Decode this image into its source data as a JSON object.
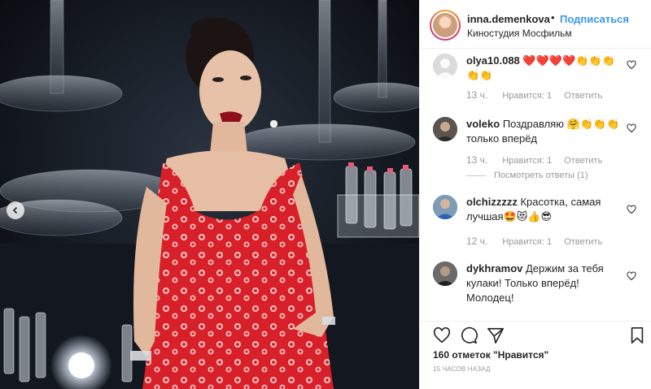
{
  "post": {
    "username": "inna.demenkova",
    "separator": "•",
    "follow_label": "Подписаться",
    "location": "Киностудия Мосфильм"
  },
  "comments": [
    {
      "username": "olya10.088",
      "text": "❤️❤️❤️❤️👏👏👏👏👏",
      "time": "13 ч.",
      "likes": "Нравится: 1",
      "reply_label": "Ответить"
    },
    {
      "username": "voleko",
      "text": "Поздравляю 🤗👏👏👏 только вперёд",
      "time": "13 ч.",
      "likes": "Нравится: 1",
      "reply_label": "Ответить",
      "view_replies": "Посмотреть ответы (1)"
    },
    {
      "username": "olchizzzzz",
      "text": "Красотка, самая лучшая🤩😻👍😎",
      "time": "12 ч.",
      "likes": "Нравится: 1",
      "reply_label": "Ответить"
    },
    {
      "username": "dykhramov",
      "text": "Держим за тебя кулаки! Только вперёд! Молодец!"
    }
  ],
  "footer": {
    "likes_text": "160 отметок \"Нравится\"",
    "posted_ago": "15 ЧАСОВ НАЗАД"
  },
  "icons": {
    "like": "heart-outline",
    "comment": "speech-bubble",
    "share": "paper-plane",
    "save": "bookmark",
    "carousel_prev": "chevron-left"
  },
  "colors": {
    "accent": "#3897f0",
    "muted": "#999999",
    "heart_red": "#ed1c24",
    "dress_red": "#d8202a"
  }
}
